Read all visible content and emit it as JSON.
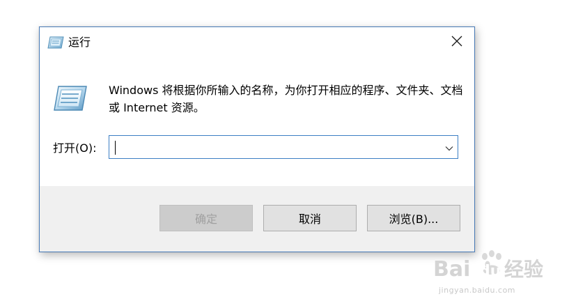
{
  "dialog": {
    "title": "运行",
    "description": "Windows 将根据你所输入的名称，为你打开相应的程序、文件夹、文档或 Internet 资源。",
    "open_label": "打开(O):",
    "open_value": "",
    "buttons": {
      "ok": "确定",
      "cancel": "取消",
      "browse": "浏览(B)..."
    },
    "icons": {
      "title": "run-icon",
      "body": "run-icon",
      "close": "close-icon",
      "dropdown": "chevron-down-icon"
    },
    "colors": {
      "border": "#4a7cb8",
      "input_border": "#3c7fc4",
      "footer": "#f0f0f0",
      "button": "#e1e1e1",
      "button_disabled": "#cccccc"
    }
  },
  "watermark": {
    "logo_text": "Bai经验",
    "url": "jingyan.baidu.com"
  }
}
